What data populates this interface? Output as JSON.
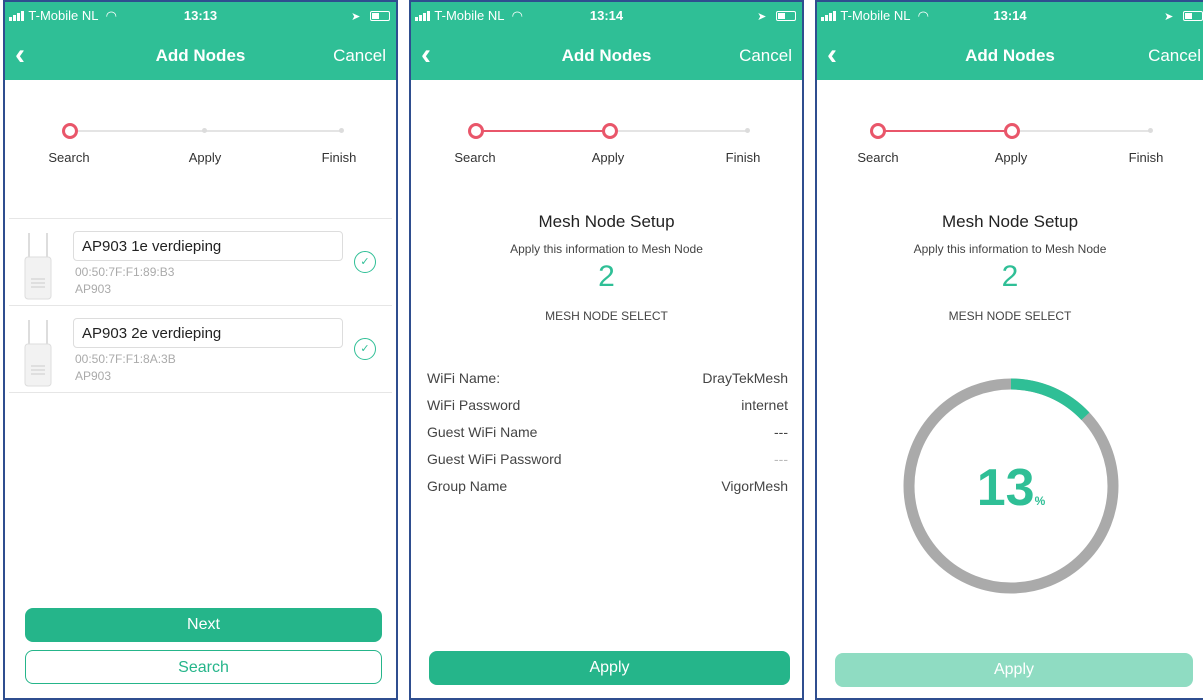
{
  "status_bar": {
    "carrier": "T-Mobile NL",
    "times": [
      "13:13",
      "13:14",
      "13:14"
    ]
  },
  "nav": {
    "title": "Add Nodes",
    "back_icon": "chevron-left-icon",
    "cancel_label": "Cancel"
  },
  "steps": [
    "Search",
    "Apply",
    "Finish"
  ],
  "screen1": {
    "nodes": [
      {
        "name": "AP903 1e verdieping",
        "mac": "00:50:7F:F1:89:B3",
        "model": "AP903",
        "checked": true
      },
      {
        "name": "AP903 2e verdieping",
        "mac": "00:50:7F:F1:8A:3B",
        "model": "AP903",
        "checked": true
      }
    ],
    "next_label": "Next",
    "search_label": "Search"
  },
  "setup": {
    "title": "Mesh Node Setup",
    "subtitle": "Apply this information to Mesh Node",
    "count": "2",
    "count_label": "MESH NODE SELECT"
  },
  "screen2": {
    "info": [
      {
        "key": "WiFi Name:",
        "value": "DrayTekMesh"
      },
      {
        "key": "WiFi Password",
        "value": "internet"
      },
      {
        "key": "Guest WiFi Name",
        "value": "---"
      },
      {
        "key": "Guest WiFi Password",
        "value": "---"
      },
      {
        "key": "Group Name",
        "value": "VigorMesh"
      }
    ],
    "apply_label": "Apply"
  },
  "screen3": {
    "progress_value": "13",
    "progress_unit": "%",
    "apply_label": "Apply"
  },
  "colors": {
    "accent": "#2fbf96",
    "step_active": "#e9566a",
    "progress_track": "#aaaaaa"
  }
}
